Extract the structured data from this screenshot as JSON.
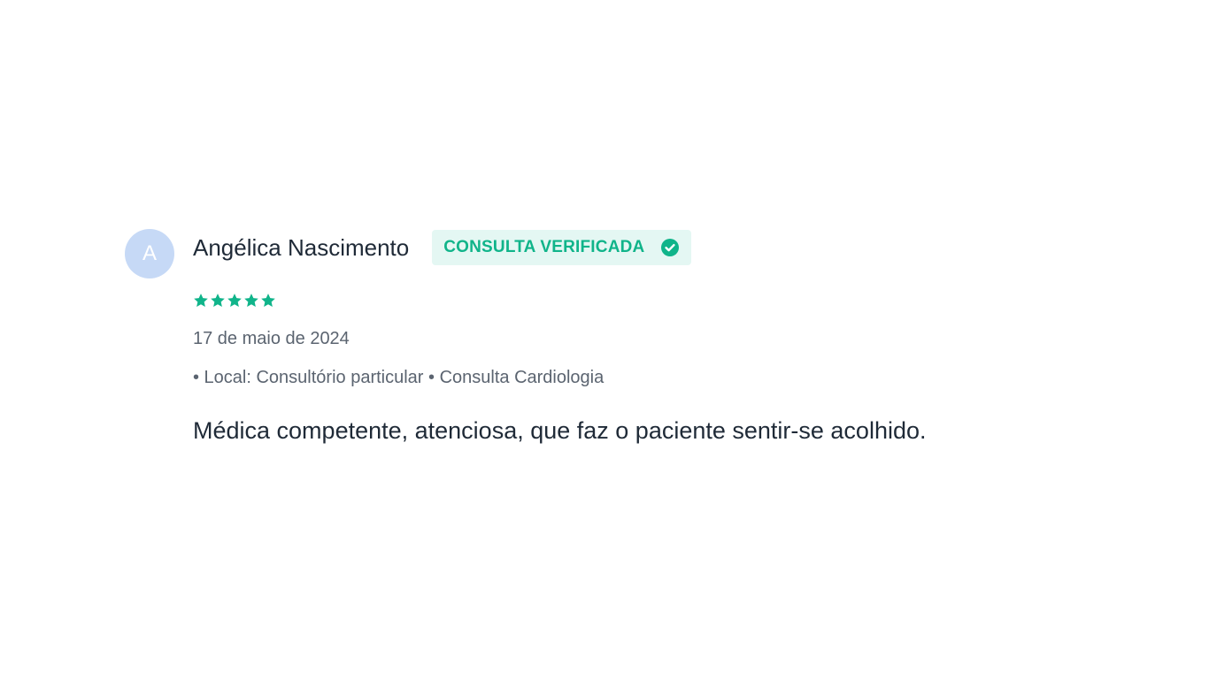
{
  "review": {
    "avatar_initial": "A",
    "author": "Angélica Nascimento",
    "badge": {
      "label": "CONSULTA VERIFICADA",
      "icon": "check-circle-icon"
    },
    "rating": 5,
    "rating_max": 5,
    "star_icon": "star-icon",
    "date": "17 de maio de 2024",
    "meta": "• Local: Consultório particular • Consulta Cardiologia",
    "comment": "Médica competente, atenciosa, que faz o paciente sentir-se acolhido."
  },
  "colors": {
    "accent": "#10b48a",
    "badge_background": "#e4f7f3",
    "avatar_background": "#c6d9f6",
    "text_primary": "#1f2a37",
    "text_secondary": "#5b6470"
  }
}
